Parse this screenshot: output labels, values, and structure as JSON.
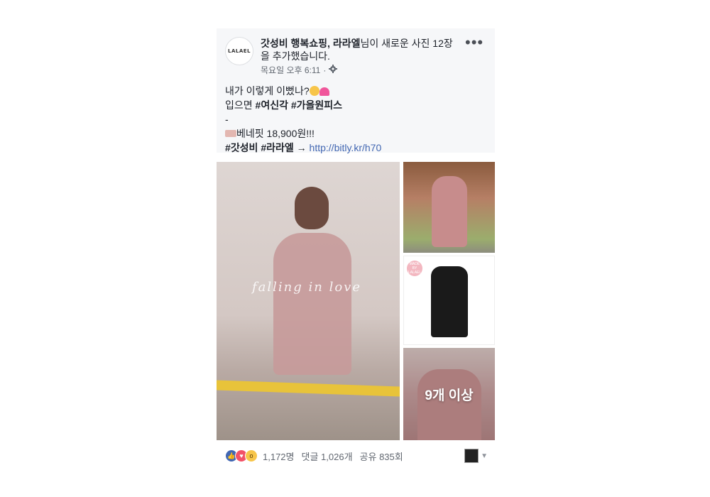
{
  "post": {
    "avatar_text": "LALAEL",
    "headline": {
      "author": "갓성비 행복쇼핑, 라라엘",
      "action": "님이 새로운 사진 12장을 추가했습니다."
    },
    "timestamp": "목요일 오후 6:11",
    "separator": "·",
    "privacy_icon": "gear-icon",
    "more_icon": "ellipsis-icon",
    "more_text": "•••"
  },
  "caption": {
    "line1": "내가 이렇게 이뻤나?",
    "line2_prefix": "입으면 ",
    "line2_tag1": "#여신각",
    "line2_tag2": "#가을원피스",
    "line3": "-",
    "line4": "베네핏 18,900원!!!",
    "line5_tag1": "#갓성비",
    "line5_tag2": "#라라엘",
    "line5_arrow": "→",
    "link": "http://bitly.kr/h70"
  },
  "photos": {
    "main_watermark": "falling in love",
    "more_overlay": "9개 이상",
    "badge_text": "MADE BY LALAEL"
  },
  "reactions": {
    "icons": [
      "like-icon",
      "love-icon",
      "wow-icon"
    ],
    "count": "1,172명",
    "comments": "댓글 1,026개",
    "shares": "공유 835회"
  },
  "colors": {
    "link": "#4267b2",
    "like": "#4267b2",
    "love": "#f25268",
    "wow": "#f7c54a",
    "header_bg": "#f6f7f9"
  }
}
